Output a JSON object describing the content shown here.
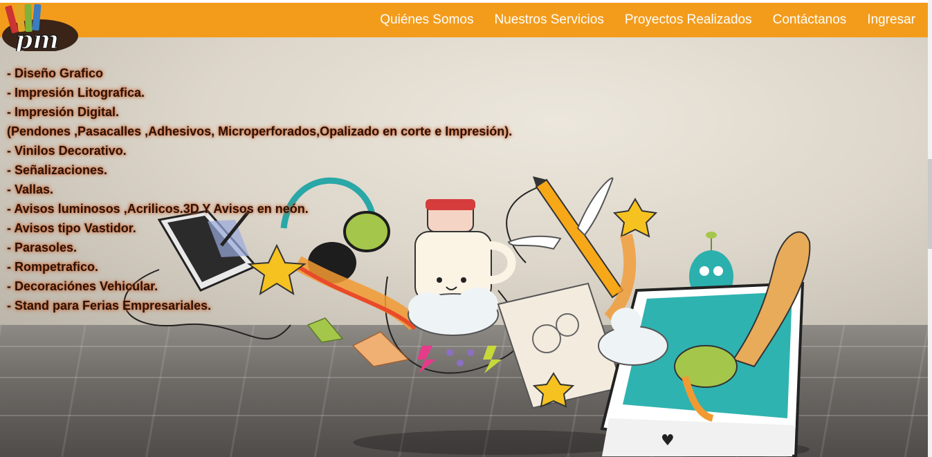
{
  "brand": {
    "logo_text": "pm"
  },
  "nav": {
    "items": [
      {
        "label": "Quiénes Somos"
      },
      {
        "label": "Nuestros Servicios"
      },
      {
        "label": "Proyectos Realizados"
      },
      {
        "label": "Contáctanos"
      },
      {
        "label": "Ingresar"
      }
    ]
  },
  "services": [
    "- Diseño Grafico",
    "- Impresión Litografica.",
    "- Impresión Digital.",
    "(Pendones ,Pasacalles ,Adhesivos, Microperforados,Opalizado en corte e Impresión).",
    "- Vinilos Decorativo.",
    "- Señalizaciones.",
    "- Vallas.",
    "- Avisos luminosos ,Acrilicos.3D Y Avisos en neón.",
    "- Avisos tipo Vastidor.",
    "- Parasoles.",
    "- Rompetrafico.",
    "- Decoraciónes Vehicular.",
    "- Stand para Ferias Empresariales."
  ],
  "colors": {
    "header": "#f39c1c",
    "service_text": "#2a1208",
    "service_glow": "#d25f28"
  }
}
